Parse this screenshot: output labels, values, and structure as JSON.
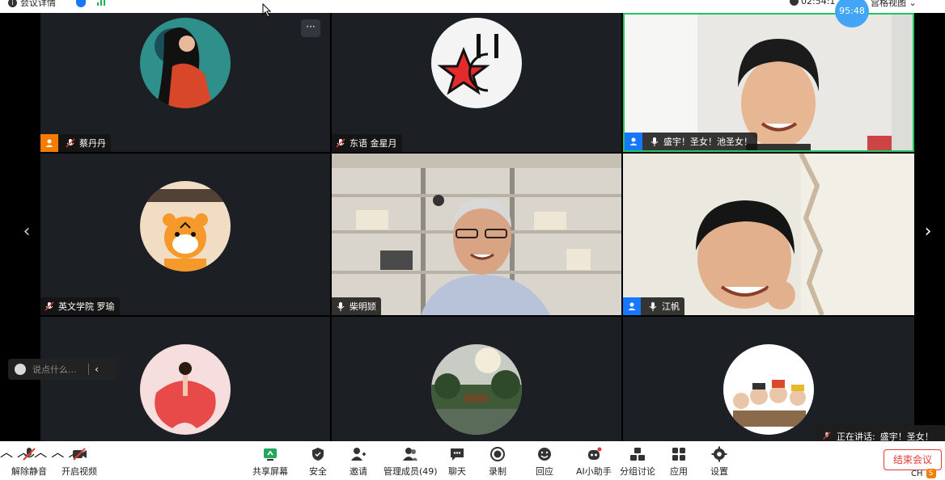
{
  "topbar": {
    "meeting_info": "会议详情",
    "clock": "02:54:1",
    "view_mode": "宫格视图"
  },
  "timer": "95:48",
  "tiles": [
    {
      "name": "蔡丹丹",
      "host": true
    },
    {
      "name": "东语 金星月"
    },
    {
      "name": "盛宇！圣女！池圣女！",
      "host": true,
      "active": true
    },
    {
      "name": "英文学院 罗瑜"
    },
    {
      "name": "柴明颎"
    },
    {
      "name": "江帆",
      "host": true
    },
    {
      "name": ""
    },
    {
      "name": ""
    },
    {
      "name": ""
    }
  ],
  "more_button": "···",
  "chat": {
    "placeholder": "说点什么..."
  },
  "speaking": {
    "label": "正在讲话:",
    "name": "盛宇！圣女！"
  },
  "toolbar": {
    "unmute": "解除静音",
    "start_video": "开启视频",
    "share_screen": "共享屏幕",
    "security": "安全",
    "invite": "邀请",
    "manage_members": "管理成员(49)",
    "chat": "聊天",
    "record": "录制",
    "reactions": "回应",
    "ai_assistant": "AI小助手",
    "breakout": "分组讨论",
    "apps": "应用",
    "settings": "设置",
    "end_meeting": "结束会议"
  },
  "ime": {
    "lang": "CH",
    "logo": "S"
  },
  "colors": {
    "accent_green": "#22c55e",
    "timer_blue": "#42a5f5",
    "end_red": "#e53935"
  }
}
